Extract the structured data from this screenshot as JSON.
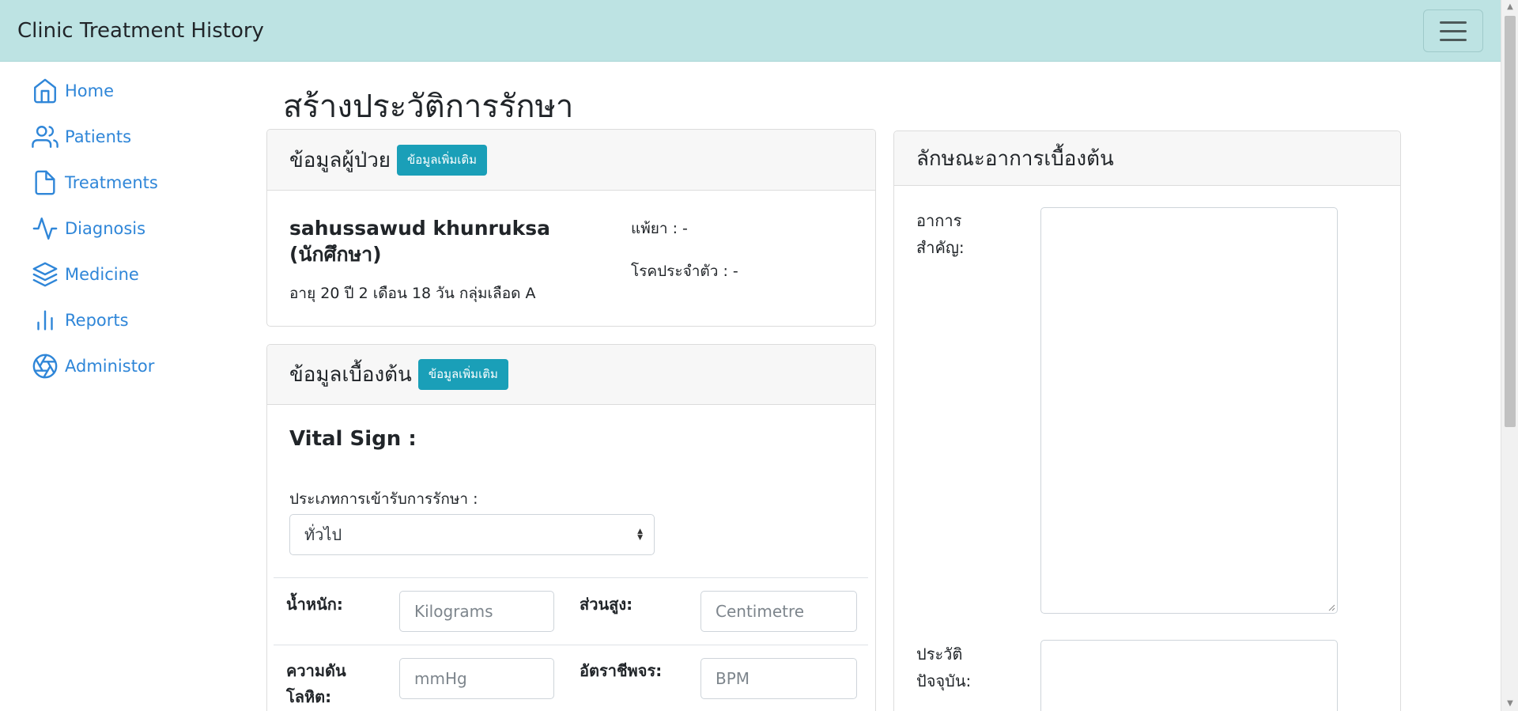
{
  "navbar": {
    "brand": "Clinic Treatment History"
  },
  "sidebar": {
    "items": [
      {
        "label": "Home",
        "icon": "home-icon"
      },
      {
        "label": "Patients",
        "icon": "users-icon"
      },
      {
        "label": "Treatments",
        "icon": "file-icon"
      },
      {
        "label": "Diagnosis",
        "icon": "activity-icon"
      },
      {
        "label": "Medicine",
        "icon": "layers-icon"
      },
      {
        "label": "Reports",
        "icon": "bar-chart-icon"
      },
      {
        "label": "Administor",
        "icon": "aperture-icon"
      }
    ]
  },
  "page": {
    "title": "สร้างประวัติการรักษา"
  },
  "patient_card": {
    "title": "ข้อมูลผู้ป่วย",
    "more_button": "ข้อมูลเพิ่มเติม",
    "name": "sahussawud khunruksa (นักศึกษา)",
    "age_blood": "อายุ 20 ปี 2 เดือน 18 วัน กลุ่มเลือด A",
    "allergy": "แพ้ยา : -",
    "chronic_disease": "โรคประจำตัว : -"
  },
  "basic_card": {
    "title": "ข้อมูลเบื้องต้น",
    "more_button": "ข้อมูลเพิ่มเติม",
    "vital_title": "Vital Sign :",
    "visit_type_label": "ประเภทการเข้ารับการรักษา :",
    "visit_type_value": "ทั่วไป",
    "weight_label": "น้ำหนัก:",
    "weight_placeholder": "Kilograms",
    "height_label": "ส่วนสูง:",
    "height_placeholder": "Centimetre",
    "bp_label": "ความดันโลหิต:",
    "bp_placeholder": "mmHg",
    "pulse_label": "อัตราชีพจร:",
    "pulse_placeholder": "BPM"
  },
  "symptom_card": {
    "title": "ลักษณะอาการเบื้องต้น",
    "chief_complaint_label": "อาการสำคัญ:",
    "present_illness_label": "ประวัติปัจจุบัน:"
  },
  "colors": {
    "navbar": "#bde3e3",
    "accent": "#1a9fb8",
    "link": "#2f86d8"
  }
}
